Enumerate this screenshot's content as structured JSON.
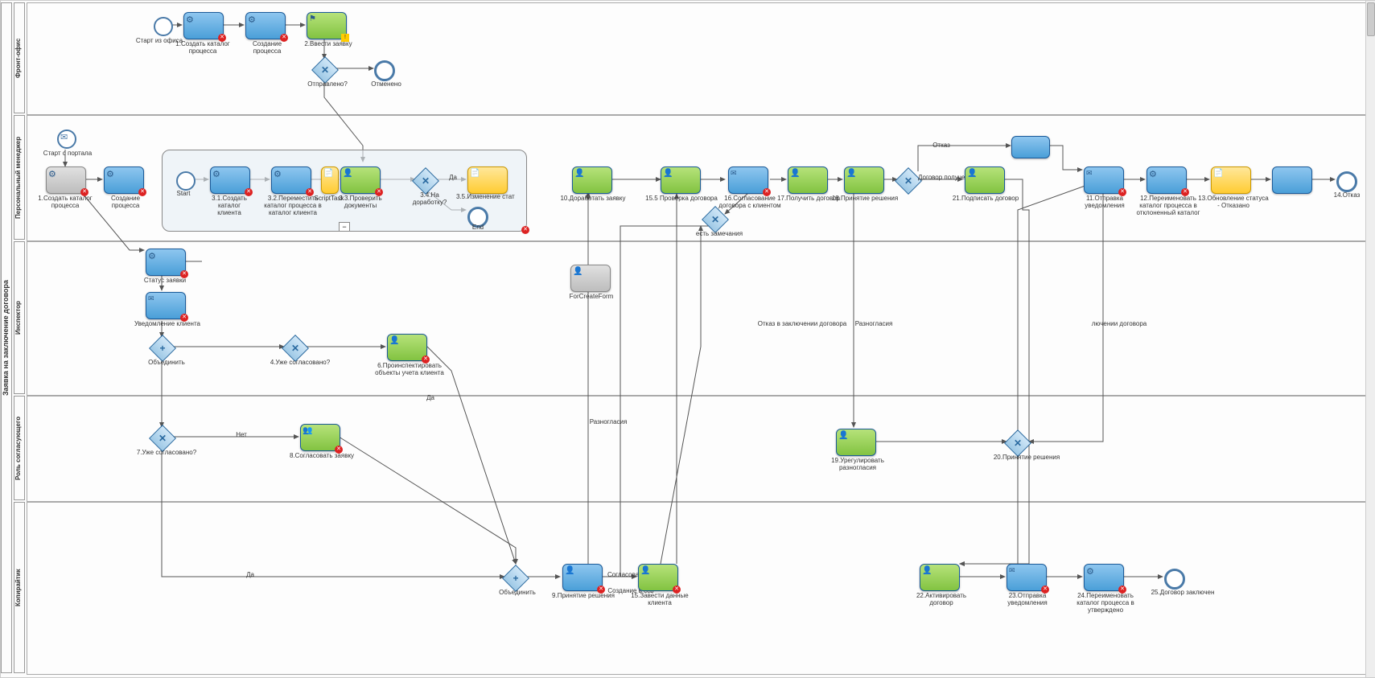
{
  "pool_label": "Заявка на заключение договора",
  "laneIcons": {
    "front": "👤",
    "pm": "👤"
  },
  "lanes": {
    "front": "Фронт-офис",
    "pm": "Персональный менеджер",
    "inspector": "Инспектор",
    "approver": "Роль согласующего",
    "curator": "Копирайтик"
  },
  "tasks": {
    "start_office": "Старт из офиса",
    "t1": "1.Создать каталог\nпроцесса",
    "t_proc1": "Создание процесса",
    "t2": "2.Ввести заявку",
    "gw_sent": "Отправлено?",
    "end_cancel": "Отменено",
    "start_portal": "Старт с портала",
    "t1b": "1.Создать каталог\nпроцесса",
    "t_proc2": "Создание процесса",
    "sp_start": "Start",
    "t31": "3.1.Создать каталог\nклиента",
    "t32": "3.2.Переместить\nкаталог процесса в\nкаталог клиента",
    "t33": "3.3.Проверить\nдокументы",
    "scripttask": "ScriptTask",
    "gw34": "3.4.На доработку?",
    "gw34_yes": "Да",
    "t35": "3.5.Изменение стат",
    "sp_end": "End",
    "t10": "10.Доработать заявку",
    "t155": "15.5 Проверка договора",
    "t16": "16.Согласование\nдоговора с клиентом",
    "t17": "17.Получить договор",
    "t18": "18.Принятие решения",
    "gw_contract": "Договор получен",
    "t21": "21.Подписать договор",
    "t11": "11.Отправка\nуведомления",
    "t12": "12.Переименовать\nкаталог процесса в\nотклоненный каталог",
    "t13": "13.Обновление статуса\n- Отказано",
    "t14": "14.Отказ",
    "gw_remarks": "есть замечания",
    "lbl_refuse": "Отказ",
    "status": "Статус заявки",
    "notify": "Уведомление клиента",
    "gw_merge1": "Объединить",
    "gw4": "4.Уже согласовано?",
    "t6": "6.Проинспектировать\nобъекты учета клиента",
    "fcf": "ForCreateForm",
    "gw_decision_refuse": "Отказ в заключении договора",
    "gw_disagree": "Разногласия",
    "gw_disagree2": "лючении договора",
    "gw7": "7.Уже согласовано?",
    "gw7_no": "Нет",
    "t8": "8.Согласовать заявку",
    "t19": "19.Урегулировать\nразногласия",
    "gw20": "20.Принятие решения",
    "gw_da": "Да",
    "gw_da2": "Да",
    "gw_merge2": "Объединить",
    "t9": "9.Принятие решения",
    "t9b": "Согласовано",
    "ccb": "Создание в ccb",
    "t15": "15.Завести данные\nклиента",
    "edge_dis": "Разногласия",
    "t22": "22.Активировать\nдоговор",
    "t23": "23.Отправка\nуведомления",
    "t24": "24.Переименовать\nкаталог процесса в\nутверждено",
    "t25": "25.Договор заключен"
  }
}
